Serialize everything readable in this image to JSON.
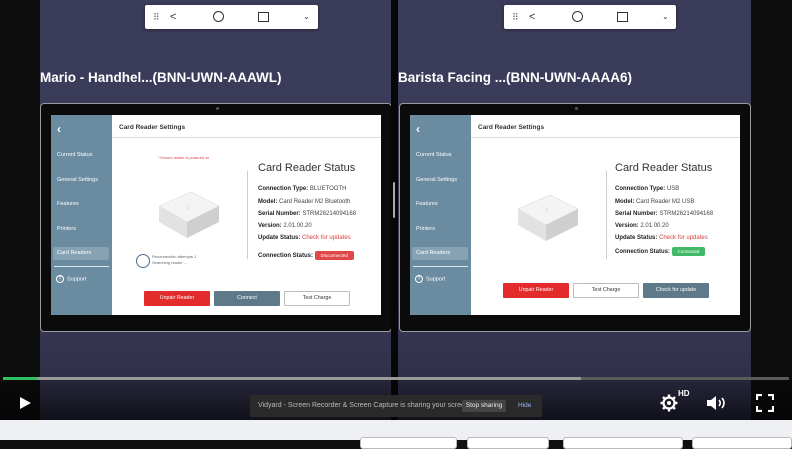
{
  "left_pane": {
    "title": "Mario - Handhel...(BNN-UWN-AAAWL)",
    "screen": {
      "header": "Card Reader Settings",
      "sidebar": {
        "items": [
          "Current Status",
          "General Settings",
          "Features",
          "Printers",
          "Card Readers"
        ],
        "active": "Card Readers",
        "support": "Support"
      },
      "powered_note": "* Ensure reader is powered on",
      "status_title": "Card Reader Status",
      "rows": [
        {
          "label": "Connection Type:",
          "value": "BLUETOOTH"
        },
        {
          "label": "Model:",
          "value": "Card Reader M2 Bluetooth"
        },
        {
          "label": "Serial Number:",
          "value": "STRM26214094168"
        },
        {
          "label": "Version:",
          "value": "2.01.00.20"
        },
        {
          "label": "Update Status:",
          "value": "Check for updates"
        }
      ],
      "connection_label": "Connection Status:",
      "connection_value": "Disconnected",
      "reconnect_line1": "Reconnection attempts 1",
      "reconnect_line2": "Searching reader ...",
      "buttons": [
        "Unpair Reader",
        "Connect",
        "Test Charge"
      ]
    }
  },
  "right_pane": {
    "title": "Barista Facing ...(BNN-UWN-AAAA6)",
    "screen": {
      "header": "Card Reader Settings",
      "sidebar": {
        "items": [
          "Current Status",
          "General Settings",
          "Features",
          "Printers",
          "Card Readers"
        ],
        "active": "Card Readers",
        "support": "Support"
      },
      "status_title": "Card Reader Status",
      "rows": [
        {
          "label": "Connection Type:",
          "value": "USB"
        },
        {
          "label": "Model:",
          "value": "Card Reader M2 USB"
        },
        {
          "label": "Serial Number:",
          "value": "STRM26214094168"
        },
        {
          "label": "Version:",
          "value": "2.01.00.20"
        },
        {
          "label": "Update Status:",
          "value": "Check for updates"
        }
      ],
      "connection_label": "Connection Status:",
      "connection_value": "Connected",
      "buttons": [
        "Unpair Reader",
        "Test Charge",
        "Check for update"
      ]
    }
  },
  "remote_bar": {
    "icons": [
      "drag-handle-icon",
      "back-icon",
      "home-icon",
      "recents-icon",
      "chevron-down-icon"
    ]
  },
  "player": {
    "played_fraction": 0.043,
    "buffered_fraction": 0.735,
    "hd_label": "HD",
    "share_notice": "Vidyard - Screen Recorder & Screen Capture is sharing your screen.",
    "stop_sharing": "Stop sharing",
    "hide": "Hide"
  },
  "colors": {
    "progress": "#2fbf5e",
    "sidebar": "#6b8ba0",
    "danger": "#e32b2b",
    "success": "#41b867",
    "slate": "#5e7989"
  }
}
